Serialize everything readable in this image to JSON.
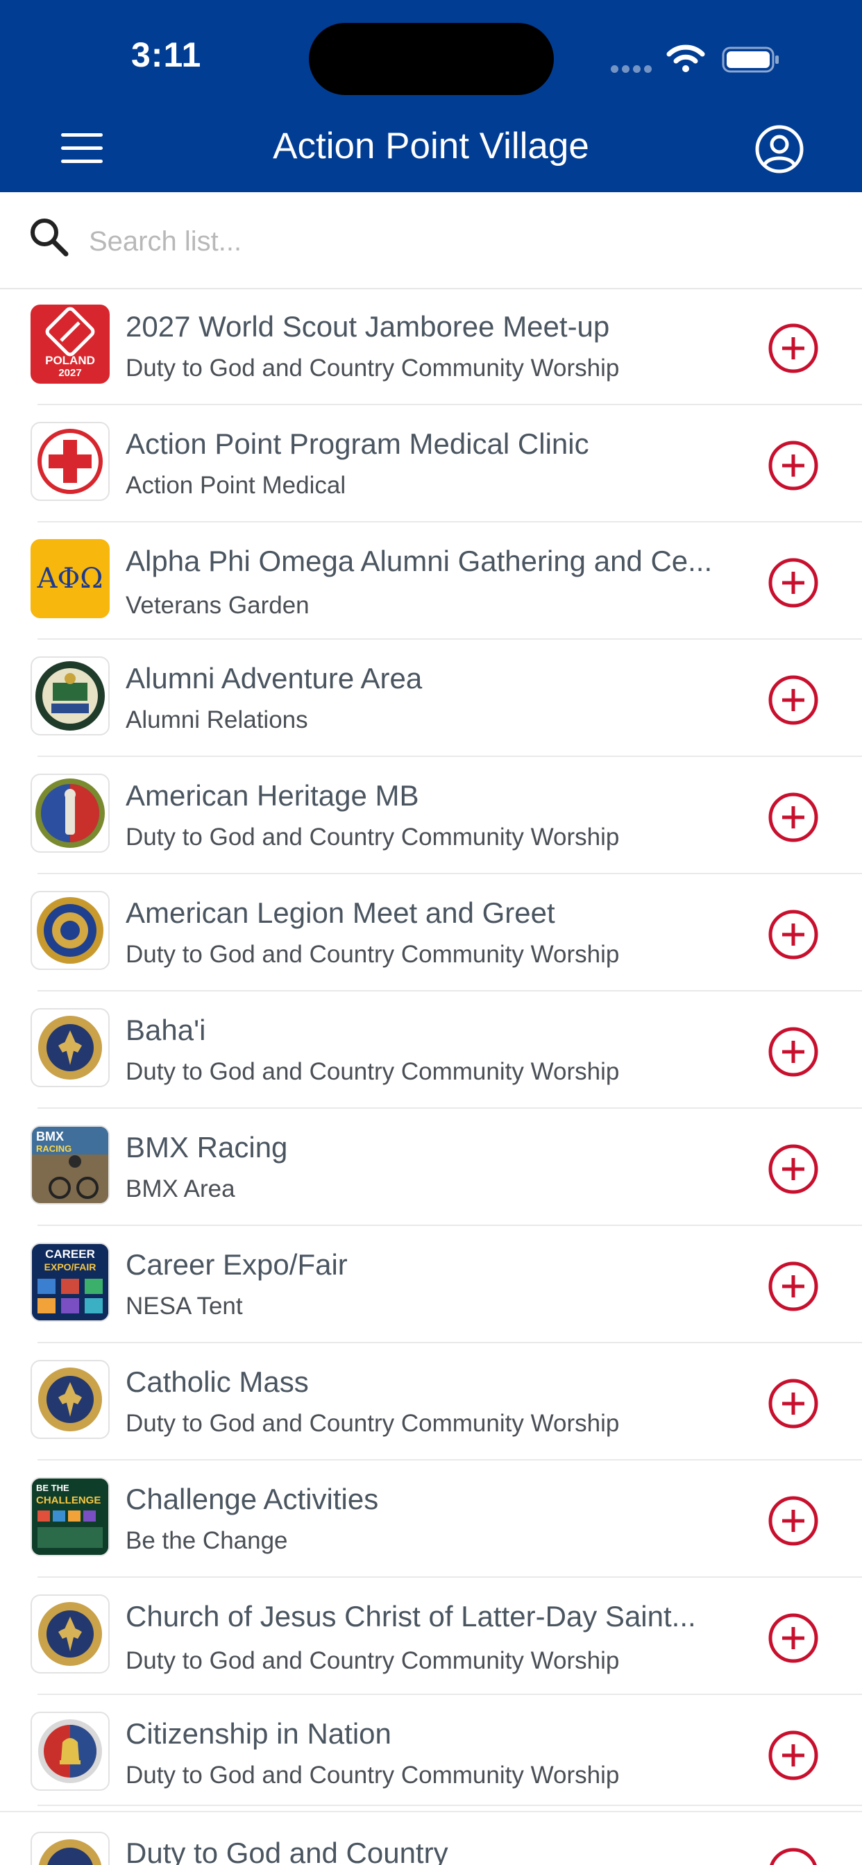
{
  "status_bar": {
    "time": "3:11"
  },
  "header": {
    "title": "Action Point Village"
  },
  "search": {
    "placeholder": "Search list..."
  },
  "items": [
    {
      "title": "2027 World Scout Jamboree Meet-up",
      "subtitle": "Duty to God and Country Community Worship",
      "thumb_text": "POLAND 2027"
    },
    {
      "title": "Action Point  Program Medical Clinic",
      "subtitle": "Action Point Medical"
    },
    {
      "title": "Alpha Phi Omega Alumni Gathering and Ce...",
      "subtitle": "Veterans Garden",
      "thumb_text": "ΑΦΩ"
    },
    {
      "title": "Alumni Adventure Area",
      "subtitle": "Alumni Relations"
    },
    {
      "title": "American Heritage MB",
      "subtitle": "Duty to God and Country Community Worship"
    },
    {
      "title": "American Legion Meet and Greet",
      "subtitle": "Duty to God and Country Community Worship"
    },
    {
      "title": "Baha'i",
      "subtitle": "Duty to God and Country Community Worship"
    },
    {
      "title": "BMX Racing",
      "subtitle": "BMX Area",
      "thumb_text": "BMX RACING"
    },
    {
      "title": "Career Expo/Fair",
      "subtitle": "NESA Tent",
      "thumb_text": "CAREER EXPO/FAIR"
    },
    {
      "title": "Catholic Mass",
      "subtitle": "Duty to God and Country Community Worship"
    },
    {
      "title": "Challenge Activities",
      "subtitle": "Be the Change",
      "thumb_text": "BE THE CHALLENGE"
    },
    {
      "title": "Church of Jesus Christ of Latter-Day Saint...",
      "subtitle": "Duty to God and Country Community Worship"
    },
    {
      "title": "Citizenship in Nation",
      "subtitle": "Duty to God and Country Community Worship"
    }
  ],
  "peek_item": {
    "title": "Duty to God and Country"
  },
  "colors": {
    "header_bg": "#023d94",
    "accent_red": "#c8102e"
  }
}
